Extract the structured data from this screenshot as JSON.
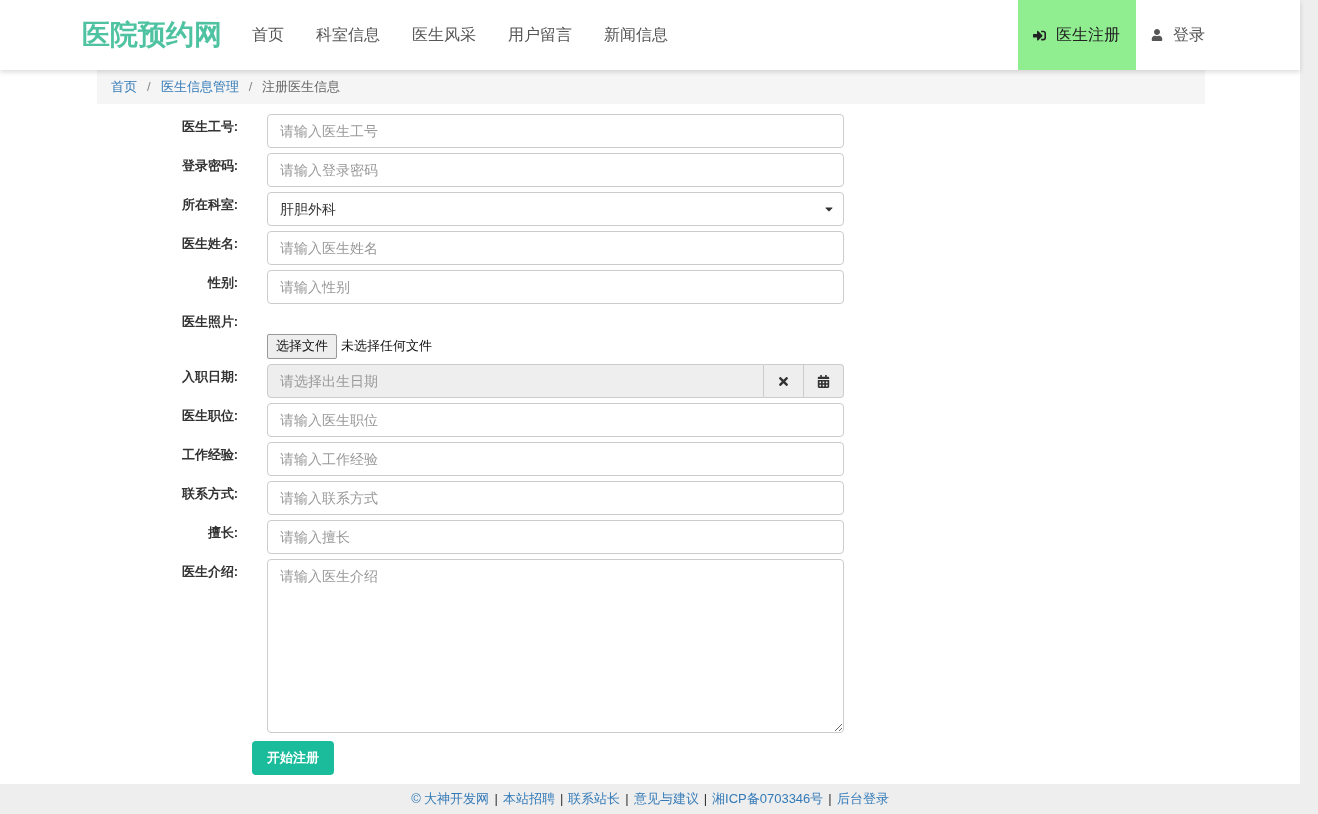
{
  "header": {
    "logo": "医院预约网",
    "nav": [
      {
        "label": "首页",
        "selected": false
      },
      {
        "label": "科室信息",
        "selected": false
      },
      {
        "label": "医生风采",
        "selected": false
      },
      {
        "label": "用户留言",
        "selected": false
      },
      {
        "label": "新闻信息",
        "selected": false
      }
    ],
    "actions": [
      {
        "label": "医生注册",
        "kind": "signin",
        "selected": true
      },
      {
        "label": "登录",
        "kind": "user",
        "selected": false
      }
    ]
  },
  "breadcrumb": {
    "links": [
      "首页",
      "医生信息管理"
    ],
    "current": "注册医生信息",
    "separator": "/"
  },
  "form": {
    "fields": [
      {
        "label": "医生工号:",
        "kind": "text",
        "placeholder": "请输入医生工号"
      },
      {
        "label": "登录密码:",
        "kind": "text",
        "placeholder": "请输入登录密码"
      },
      {
        "label": "所在科室:",
        "kind": "select",
        "value": "肝胆外科"
      },
      {
        "label": "医生姓名:",
        "kind": "text",
        "placeholder": "请输入医生姓名"
      },
      {
        "label": "性别:",
        "kind": "text",
        "placeholder": "请输入性别"
      },
      {
        "label": "医生照片:",
        "kind": "file",
        "button": "选择文件",
        "status": "未选择任何文件"
      },
      {
        "label": "入职日期:",
        "kind": "date",
        "placeholder": "请选择出生日期"
      },
      {
        "label": "医生职位:",
        "kind": "text",
        "placeholder": "请输入医生职位"
      },
      {
        "label": "工作经验:",
        "kind": "text",
        "placeholder": "请输入工作经验"
      },
      {
        "label": "联系方式:",
        "kind": "text",
        "placeholder": "请输入联系方式"
      },
      {
        "label": "擅长:",
        "kind": "text",
        "placeholder": "请输入擅长"
      },
      {
        "label": "医生介绍:",
        "kind": "textarea",
        "placeholder": "请输入医生介绍"
      }
    ],
    "submit": "开始注册"
  },
  "footer": {
    "separator": "|",
    "links": [
      "© 大神开发网",
      "本站招聘",
      "联系站长",
      "意见与建议",
      "湘ICP备0703346号",
      "后台登录"
    ]
  }
}
